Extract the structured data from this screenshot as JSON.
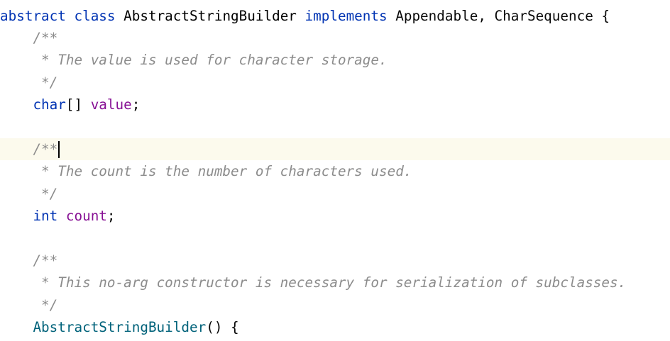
{
  "editor": {
    "current_line": 6,
    "lines": [
      [
        {
          "t": "abstract",
          "k": "kw"
        },
        {
          "t": " "
        },
        {
          "t": "class",
          "k": "kw"
        },
        {
          "t": " "
        },
        {
          "t": "AbstractStringBuilder",
          "k": "cls"
        },
        {
          "t": " "
        },
        {
          "t": "implements",
          "k": "kw"
        },
        {
          "t": " "
        },
        {
          "t": "Appendable, CharSequence {",
          "k": "txt"
        }
      ],
      [
        {
          "t": "    "
        },
        {
          "t": "/**",
          "k": "cmt"
        }
      ],
      [
        {
          "t": "     "
        },
        {
          "t": "* The value is used for character storage.",
          "k": "cmt"
        }
      ],
      [
        {
          "t": "     "
        },
        {
          "t": "*/",
          "k": "cmt"
        }
      ],
      [
        {
          "t": "    "
        },
        {
          "t": "char",
          "k": "kw"
        },
        {
          "t": "[] ",
          "k": "txt"
        },
        {
          "t": "value",
          "k": "fld"
        },
        {
          "t": ";",
          "k": "txt"
        }
      ],
      [],
      [
        {
          "t": "    "
        },
        {
          "t": "/**",
          "k": "cmt"
        }
      ],
      [
        {
          "t": "     "
        },
        {
          "t": "* The count is the number of characters used.",
          "k": "cmt"
        }
      ],
      [
        {
          "t": "     "
        },
        {
          "t": "*/",
          "k": "cmt"
        }
      ],
      [
        {
          "t": "    "
        },
        {
          "t": "int",
          "k": "kw"
        },
        {
          "t": " "
        },
        {
          "t": "count",
          "k": "fld"
        },
        {
          "t": ";",
          "k": "txt"
        }
      ],
      [],
      [
        {
          "t": "    "
        },
        {
          "t": "/**",
          "k": "cmt"
        }
      ],
      [
        {
          "t": "     "
        },
        {
          "t": "* This no-arg constructor is necessary for serialization of subclasses.",
          "k": "cmt"
        }
      ],
      [
        {
          "t": "     "
        },
        {
          "t": "*/",
          "k": "cmt"
        }
      ],
      [
        {
          "t": "    "
        },
        {
          "t": "AbstractStringBuilder",
          "k": "ctor"
        },
        {
          "t": "() {",
          "k": "txt"
        }
      ]
    ]
  }
}
